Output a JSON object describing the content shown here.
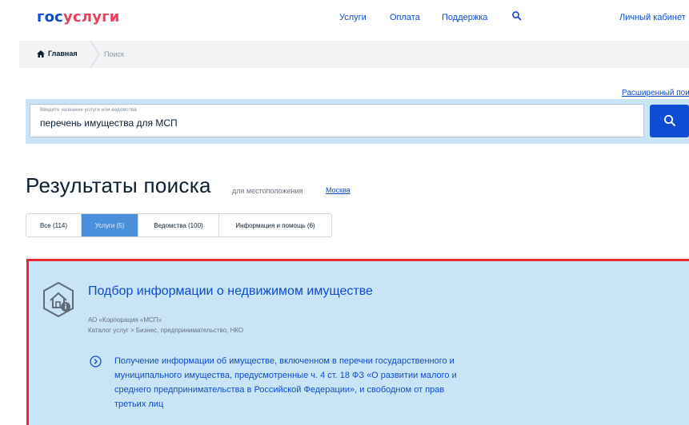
{
  "header": {
    "logo_part1": "гос",
    "logo_part2": "услуги",
    "nav": [
      "Услуги",
      "Оплата",
      "Поддержка"
    ],
    "cabinet": "Личный кабинет"
  },
  "breadcrumb": {
    "home": "Главная",
    "current": "Поиск"
  },
  "advanced_search": "Расширенный пои",
  "search": {
    "placeholder": "Введите название услуги или ведомства",
    "value": "перечень имущества для МСП"
  },
  "results": {
    "title": "Результаты поиска",
    "location_label": "для местоположения",
    "location": "Москва"
  },
  "tabs": [
    {
      "label": "Все (114)",
      "active": false
    },
    {
      "label": "Услуги (5)",
      "active": true
    },
    {
      "label": "Ведомства (100)",
      "active": false
    },
    {
      "label": "Информация и помощь (6)",
      "active": false
    }
  ],
  "card": {
    "title": "Подбор информации о недвижимом имуществе",
    "org": "АО «Корпорация «МСП»",
    "category": "Каталог услуг > Бизнес, предпринимательство, НКО",
    "description_lines": [
      "Получение информации об имуществе, включенном в перечни государственного и",
      "муниципального имущества, предусмотренные ч. 4 ст. 18 ФЗ «О развитии малого и",
      "среднего предпринимательства в Российской Федерации», и свободном от прав",
      "третьих лиц"
    ]
  },
  "colors": {
    "brand_blue": "#0d4cd3",
    "brand_red": "#ee3f58",
    "highlight_border": "#e8282b",
    "panel_bg": "#c9e3f7"
  }
}
